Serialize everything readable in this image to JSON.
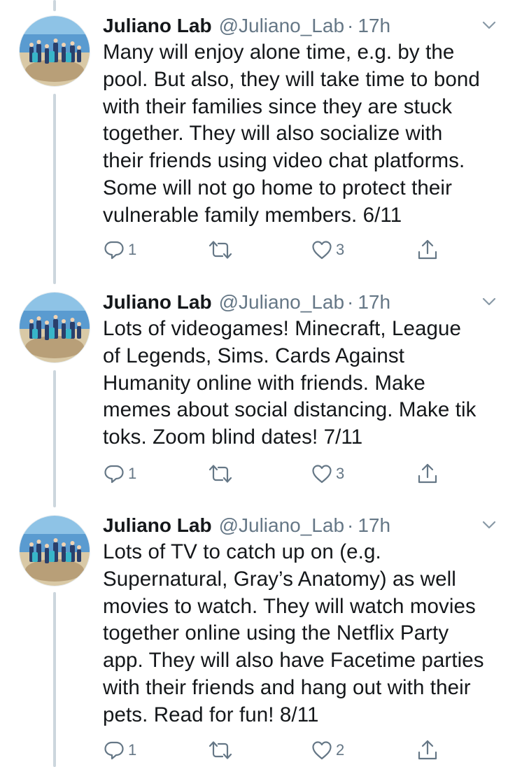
{
  "colors": {
    "text": "#14171a",
    "secondary": "#657786",
    "thread_line": "#ccd6dd"
  },
  "tweets": [
    {
      "author": "Juliano Lab",
      "handle": "@Juliano_Lab",
      "separator": "·",
      "time": "17h",
      "text": "Many will enjoy alone time, e.g. by the\npool. But also, they will take time to bond\nwith their families since they are stuck\ntogether. They will also socialize with\ntheir friends using video chat platforms.\nSome will not go home to protect their\nvulnerable family members. 6/11",
      "reply_count": "1",
      "like_count": "3",
      "icons": [
        "reply-icon",
        "retweet-icon",
        "like-icon",
        "share-icon"
      ]
    },
    {
      "author": "Juliano Lab",
      "handle": "@Juliano_Lab",
      "separator": "·",
      "time": "17h",
      "text": "Lots of videogames! Minecraft, League\nof Legends, Sims. Cards Against\nHumanity online with friends. Make\nmemes about social distancing. Make tik\ntoks. Zoom blind dates! 7/11",
      "reply_count": "1",
      "like_count": "3",
      "icons": [
        "reply-icon",
        "retweet-icon",
        "like-icon",
        "share-icon"
      ]
    },
    {
      "author": "Juliano Lab",
      "handle": "@Juliano_Lab",
      "separator": "·",
      "time": "17h",
      "text": "Lots of TV to catch up on (e.g.\nSupernatural, Gray’s Anatomy) as well\nmovies to watch. They will watch movies\ntogether online using the Netflix Party\napp. They will also have Facetime parties\nwith their friends and hang out with their\npets. Read for fun! 8/11",
      "reply_count": "1",
      "like_count": "2",
      "icons": [
        "reply-icon",
        "retweet-icon",
        "like-icon",
        "share-icon"
      ]
    }
  ]
}
